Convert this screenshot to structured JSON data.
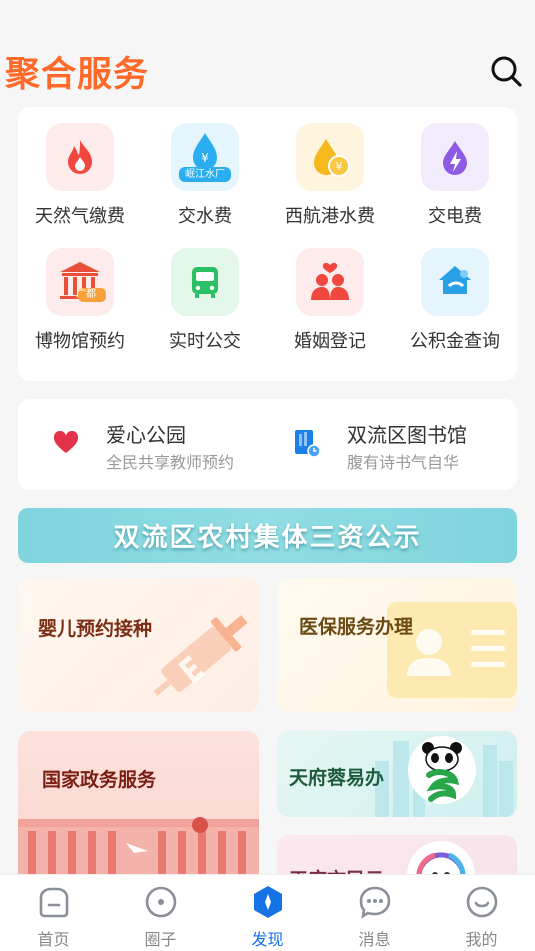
{
  "header": {
    "title": "聚合服务"
  },
  "services": [
    {
      "label": "天然气缴费",
      "icon": "flame-icon"
    },
    {
      "label": "交水费",
      "icon": "water-drop-icon",
      "badge": "岷江水厂"
    },
    {
      "label": "西航港水费",
      "icon": "water-coin-icon"
    },
    {
      "label": "交电费",
      "icon": "electricity-drop-icon"
    },
    {
      "label": "博物馆预约",
      "icon": "museum-icon",
      "badge": "广都"
    },
    {
      "label": "实时公交",
      "icon": "bus-icon"
    },
    {
      "label": "婚姻登记",
      "icon": "couple-icon"
    },
    {
      "label": "公积金查询",
      "icon": "house-fund-icon"
    }
  ],
  "quick": [
    {
      "title": "爱心公园",
      "subtitle": "全民共享教师预约",
      "icon": "heart-icon"
    },
    {
      "title": "双流区图书馆",
      "subtitle": "腹有诗书气自华",
      "icon": "library-icon"
    }
  ],
  "banner": {
    "text": "双流区农村集体三资公示"
  },
  "tiles": {
    "infant_vaccine": "婴儿预约接种",
    "medical_insurance": "医保服务办理",
    "national_gov": "国家政务服务",
    "tianfu_rongyiban": "天府蓉易办",
    "tianfu_shiminyun": "天府市民云"
  },
  "tabs": [
    {
      "label": "首页",
      "icon": "home-icon",
      "active": false
    },
    {
      "label": "圈子",
      "icon": "circle-icon",
      "active": false
    },
    {
      "label": "发现",
      "icon": "compass-icon",
      "active": true
    },
    {
      "label": "消息",
      "icon": "message-icon",
      "active": false
    },
    {
      "label": "我的",
      "icon": "profile-icon",
      "active": false
    }
  ],
  "colors": {
    "title": "#ff6a2b",
    "accent": "#1573e6",
    "banner": "#86d7df"
  }
}
